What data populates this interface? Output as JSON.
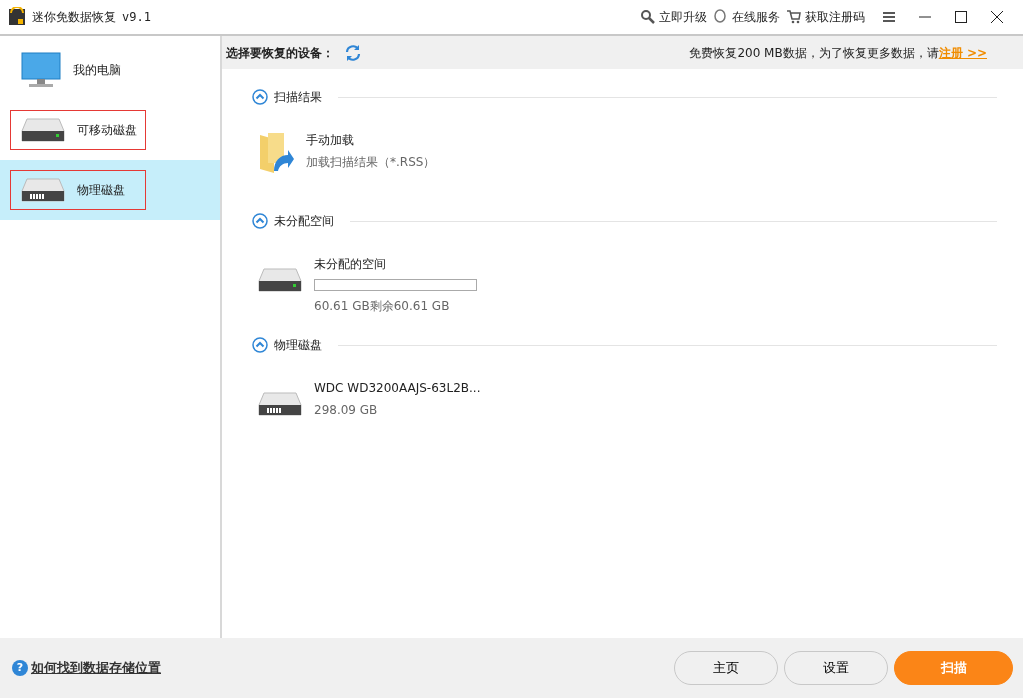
{
  "window": {
    "title": "迷你免数据恢复",
    "version": "v9.1",
    "actions": [
      {
        "kind": "upgrade",
        "label": "立即升级"
      },
      {
        "kind": "service",
        "label": "在线服务"
      },
      {
        "kind": "cart",
        "label": "获取注册码"
      }
    ]
  },
  "sidebar": {
    "items": [
      {
        "kind": "computer",
        "label": "我的电脑",
        "selected": false,
        "outlined": false
      },
      {
        "kind": "removable",
        "label": "可移动磁盘",
        "selected": false,
        "outlined": true
      },
      {
        "kind": "physical",
        "label": "物理磁盘",
        "selected": true,
        "outlined": true
      }
    ]
  },
  "header": {
    "label": "选择要恢复的设备：",
    "notice": "免费恢复200 MB数据，为了恢复更多数据，请",
    "link": "注册 >>"
  },
  "sections": [
    {
      "title": "扫描结果",
      "expanded": true,
      "items": [
        {
          "kind": "folder",
          "name": "手动加载",
          "detail": "加载扫描结果（*.RSS）"
        }
      ]
    },
    {
      "title": "未分配空间",
      "expanded": true,
      "items": [
        {
          "kind": "space",
          "name": "未分配的空间",
          "level": 0,
          "detail": "60.61 GB剩余60.61 GB"
        }
      ]
    },
    {
      "title": "物理磁盘",
      "expanded": true,
      "items": [
        {
          "kind": "disk",
          "name": "WDC WD3200AAJS-63L2B...",
          "detail": "298.09 GB"
        }
      ]
    }
  ],
  "footer": {
    "help_icon": "?",
    "help": "如何找到数据存储位置",
    "buttons": [
      {
        "kind": "secondary",
        "label": "主页"
      },
      {
        "kind": "secondary",
        "label": "设置"
      },
      {
        "kind": "primary",
        "label": "扫描"
      }
    ]
  }
}
